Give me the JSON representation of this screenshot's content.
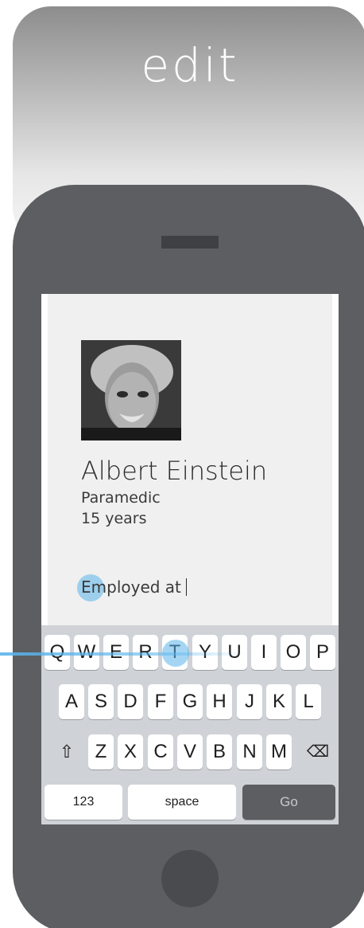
{
  "header": {
    "title": "edit"
  },
  "profile": {
    "name": "Albert Einstein",
    "role": "Paramedic",
    "years": "15 years",
    "employed_label": "Employed at"
  },
  "keyboard": {
    "row1": [
      "Q",
      "W",
      "E",
      "R",
      "T",
      "Y",
      "U",
      "I",
      "O",
      "P"
    ],
    "row2": [
      "A",
      "S",
      "D",
      "F",
      "G",
      "H",
      "J",
      "K",
      "L"
    ],
    "row3": [
      "Z",
      "X",
      "C",
      "V",
      "B",
      "N",
      "M"
    ],
    "shift_icon": "⇧",
    "delete_icon": "⌫",
    "numbers_label": "123",
    "space_label": "space",
    "go_label": "Go"
  },
  "colors": {
    "phone_body": "#5d5e61",
    "screen": "#f0f0f0",
    "keyboard": "#cfd2d7",
    "touch_highlight": "#5ab4eb"
  }
}
